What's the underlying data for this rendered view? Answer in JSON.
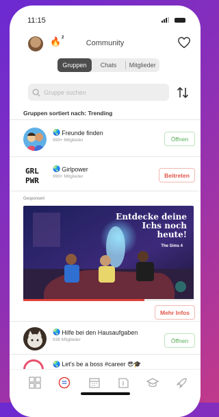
{
  "status": {
    "time": "11:15"
  },
  "header": {
    "title": "Community",
    "fire_count": "2"
  },
  "tabs": [
    {
      "label": "Gruppen"
    },
    {
      "label": "Chats"
    },
    {
      "label": "Mitglieder"
    }
  ],
  "search": {
    "placeholder": "Gruppe suchen"
  },
  "sorted_label": "Gruppen sortiert nach: Trending",
  "groups": [
    {
      "name": "Freunde finden",
      "members": "999+ Mitglieder",
      "action": "Öffnen"
    },
    {
      "name": "Girlpower",
      "members": "999+ Mitglieder",
      "action": "Beitreten",
      "avatar_text_1": "GRL",
      "avatar_text_2": "PWR"
    },
    {
      "name": "Hilfe bei den Hausaufgaben",
      "members": "938 Mitglieder",
      "action": "Öffnen"
    },
    {
      "name": "Let's be a boss #career 😎🎓",
      "members": "",
      "action": ""
    }
  ],
  "ad": {
    "sponsored": "Gesponsert",
    "headline": "Entdecke deine Ichs noch heute!",
    "logo": "The Sims 4",
    "progress": 0.71,
    "cta": "Mehr Infos"
  },
  "colors": {
    "accent_red": "#e0564a",
    "accent_green": "#55ad55",
    "segment_active": "#4d4d4d"
  }
}
